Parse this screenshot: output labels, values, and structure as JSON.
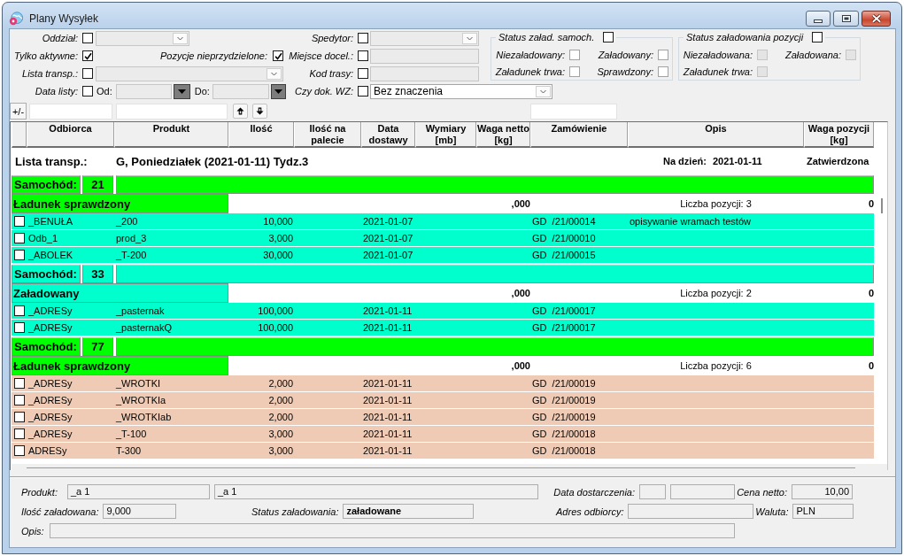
{
  "window": {
    "title": "Plany Wysyłek"
  },
  "filters": {
    "rows": [
      {
        "label": "Oddział:",
        "checked": false,
        "field": {
          "kind": "combo",
          "disabled": true
        },
        "right": {
          "label": "Spedytor:",
          "checked": false,
          "field": {
            "kind": "combo",
            "disabled": true
          }
        }
      },
      {
        "label": "Tylko aktywne:",
        "checked": true,
        "field": {
          "kind": "check",
          "label": "Pozycje nieprzydzielone:",
          "checked": true
        },
        "right": {
          "label": "Miejsce docel.:",
          "checked": false,
          "field": {
            "kind": "text",
            "disabled": true
          }
        }
      },
      {
        "label": "Lista transp.:",
        "checked": false,
        "field": {
          "kind": "combo",
          "disabled": true
        },
        "right": {
          "label": "Kod trasy:",
          "checked": false,
          "field": {
            "kind": "text",
            "disabled": true
          }
        }
      },
      {
        "label": "Data listy:",
        "checked": false,
        "field": {
          "kind": "date_range",
          "from_label": "Od:",
          "to_label": "Do:",
          "disabled": true
        },
        "right": {
          "label": "Czy dok. WZ:",
          "checked": false,
          "field": {
            "kind": "combo",
            "value": "Bez znaczenia",
            "disabled": false
          }
        }
      }
    ],
    "groups": [
      {
        "title": "Status załad. samoch.",
        "checked": false,
        "items": [
          {
            "label": "Niezaładowany:",
            "checked": false,
            "disabled": false
          },
          {
            "label": "Załadowany:",
            "checked": false,
            "disabled": false
          },
          {
            "label": "Załadunek trwa:",
            "checked": false,
            "disabled": false
          },
          {
            "label": "Sprawdzony:",
            "checked": false,
            "disabled": false
          }
        ]
      },
      {
        "title": "Status załadowania pozycji",
        "checked": false,
        "items": [
          {
            "label": "Niezaładowana:",
            "checked": false,
            "disabled": true
          },
          {
            "label": "Załadowana:",
            "checked": false,
            "disabled": true
          },
          {
            "label": "Załadunek trwa:",
            "checked": false,
            "disabled": true
          }
        ]
      }
    ]
  },
  "toolbar": {
    "toggle_label": "+/-"
  },
  "table": {
    "columns": [
      "Odbiorca",
      "Produkt",
      "Ilość",
      "Ilość na palecie",
      "Data dostawy",
      "Wymiary [mb]",
      "Waga netto [kg]",
      "Zamówienie",
      "Opis",
      "Waga pozycji [kg]"
    ],
    "list": {
      "label": "Lista transp.:",
      "name": "G, Poniedziałek (2021-01-11) Tydz.3",
      "date_label": "Na dzień:",
      "date": "2021-01-11",
      "status": "Zatwierdzona"
    },
    "groups": [
      {
        "car": {
          "label": "Samochód:",
          "number": "21",
          "color": "#00ff00"
        },
        "status": {
          "text": "Ładunek sprawdzony",
          "color": "#00ff00"
        },
        "net_weight": ",000",
        "item_count": "Liczba pozycji: 3",
        "item_weight": "0",
        "rows": [
          {
            "checked": false,
            "color": "#00ffcc",
            "recipient": "_BENUŁA",
            "product": "_200",
            "quantity": "10,000",
            "delivery_date": "2021-01-07",
            "order": "GD  /21/00014",
            "description": "opisywanie wramach testów"
          },
          {
            "checked": false,
            "color": "#00ffcc",
            "recipient": "Odb_1",
            "product": "prod_3",
            "quantity": "3,000",
            "delivery_date": "2021-01-07",
            "order": "GD  /21/00010"
          },
          {
            "checked": false,
            "color": "#00ffcc",
            "recipient": "_ABOLEK",
            "product": "_T-200",
            "quantity": "30,000",
            "delivery_date": "2021-01-07",
            "order": "GD  /21/00015"
          }
        ]
      },
      {
        "car": {
          "label": "Samochód:",
          "number": "33",
          "color": "#00ffcc"
        },
        "status": {
          "text": "Załadowany",
          "color": "#00ffcc"
        },
        "net_weight": ",000",
        "item_count": "Liczba pozycji: 2",
        "item_weight": "0",
        "rows": [
          {
            "checked": false,
            "color": "#00ffcc",
            "recipient": "_ADRESy",
            "product": "_pasternak",
            "quantity": "100,000",
            "delivery_date": "2021-01-11",
            "order": "GD  /21/00017"
          },
          {
            "checked": false,
            "color": "#00ffcc",
            "recipient": "_ADRESy",
            "product": "_pasternakQ",
            "quantity": "100,000",
            "delivery_date": "2021-01-11",
            "order": "GD  /21/00017"
          }
        ]
      },
      {
        "car": {
          "label": "Samochód:",
          "number": "77",
          "color": "#00ff00"
        },
        "status": {
          "text": "Ładunek sprawdzony",
          "color": "#00ff00"
        },
        "net_weight": ",000",
        "item_count": "Liczba pozycji: 6",
        "item_weight": "0",
        "rows": [
          {
            "checked": false,
            "color": "#efcbb5",
            "recipient": "_ADRESy",
            "product": "_WROTKI",
            "quantity": "2,000",
            "delivery_date": "2021-01-11",
            "order": "GD  /21/00019"
          },
          {
            "checked": false,
            "color": "#efcbb5",
            "recipient": "_ADRESy",
            "product": "_WROTKIa",
            "quantity": "2,000",
            "delivery_date": "2021-01-11",
            "order": "GD  /21/00019"
          },
          {
            "checked": false,
            "color": "#efcbb5",
            "recipient": "_ADRESy",
            "product": "_WROTKIab",
            "quantity": "2,000",
            "delivery_date": "2021-01-11",
            "order": "GD  /21/00019"
          },
          {
            "checked": false,
            "color": "#efcbb5",
            "recipient": "_ADRESy",
            "product": "_T-100",
            "quantity": "3,000",
            "delivery_date": "2021-01-11",
            "order": "GD  /21/00018"
          },
          {
            "checked": false,
            "color": "#efcbb5",
            "recipient": "ADRESy",
            "product": "T-300",
            "quantity": "3,000",
            "delivery_date": "2021-01-11",
            "order": "GD  /21/00018"
          }
        ]
      }
    ]
  },
  "details": {
    "product": {
      "label": "Produkt:",
      "code": "_a 1",
      "name": "_a 1"
    },
    "delivery_date": {
      "label": "Data dostarczenia:"
    },
    "net_price": {
      "label": "Cena netto:",
      "value": "10,00"
    },
    "loaded_quantity": {
      "label": "Ilość załadowana:",
      "value": "9,000"
    },
    "load_status": {
      "label": "Status załadowania:",
      "value": "załadowane"
    },
    "address": {
      "label": "Adres odbiorcy:"
    },
    "currency": {
      "label": "Waluta:",
      "value": "PLN"
    },
    "description": {
      "label": "Opis:"
    }
  }
}
